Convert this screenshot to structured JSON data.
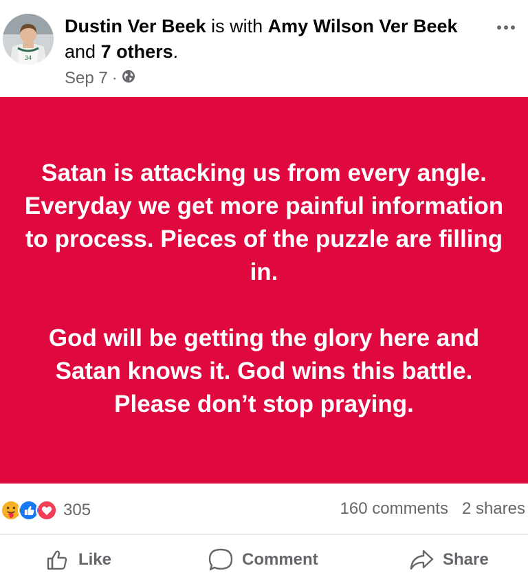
{
  "post": {
    "author": "Dustin Ver Beek",
    "with_word": "is with",
    "tagged_person": "Amy Wilson Ver Beek",
    "and_word": "and",
    "others": "7 others",
    "period": ".",
    "date": "Sep 7",
    "separator": "·",
    "privacy_icon": "globe-icon",
    "avatar_jersey_number": "34",
    "background_color": "#e0093f",
    "text_paragraphs": [
      "Satan is attacking us from every angle.  Everyday we get more painful information to process. Pieces of the puzzle are filling in.",
      "God will be getting the glory here and Satan knows it. God wins this battle. Please don’t stop praying."
    ]
  },
  "stats": {
    "reactions_count": "305",
    "reaction_icons": [
      "care-icon",
      "like-icon",
      "love-icon"
    ],
    "comments": "160 comments",
    "shares": "2 shares"
  },
  "actions": {
    "like": "Like",
    "comment": "Comment",
    "share": "Share"
  }
}
